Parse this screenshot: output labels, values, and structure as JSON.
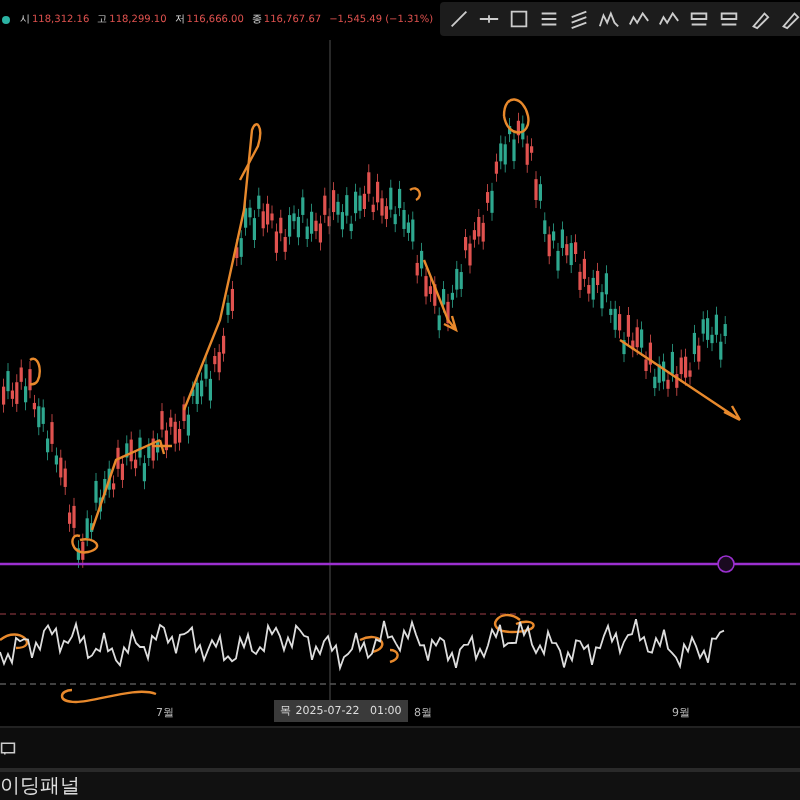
{
  "legend": {
    "items": [
      {
        "label": "시",
        "value": "118,312.16"
      },
      {
        "label": "고",
        "value": "118,299.10"
      },
      {
        "label": "저",
        "value": "116,666.00"
      },
      {
        "label": "종",
        "value": "116,767.67"
      }
    ],
    "change": "−1,545.49 (−1.31%)"
  },
  "x_axis": {
    "labels": [
      "7월",
      "8월",
      "9월"
    ],
    "crosshair_label": "목 2025-07-22   01:00"
  },
  "bottom_panel": {
    "tab": "이딩패널"
  }
}
